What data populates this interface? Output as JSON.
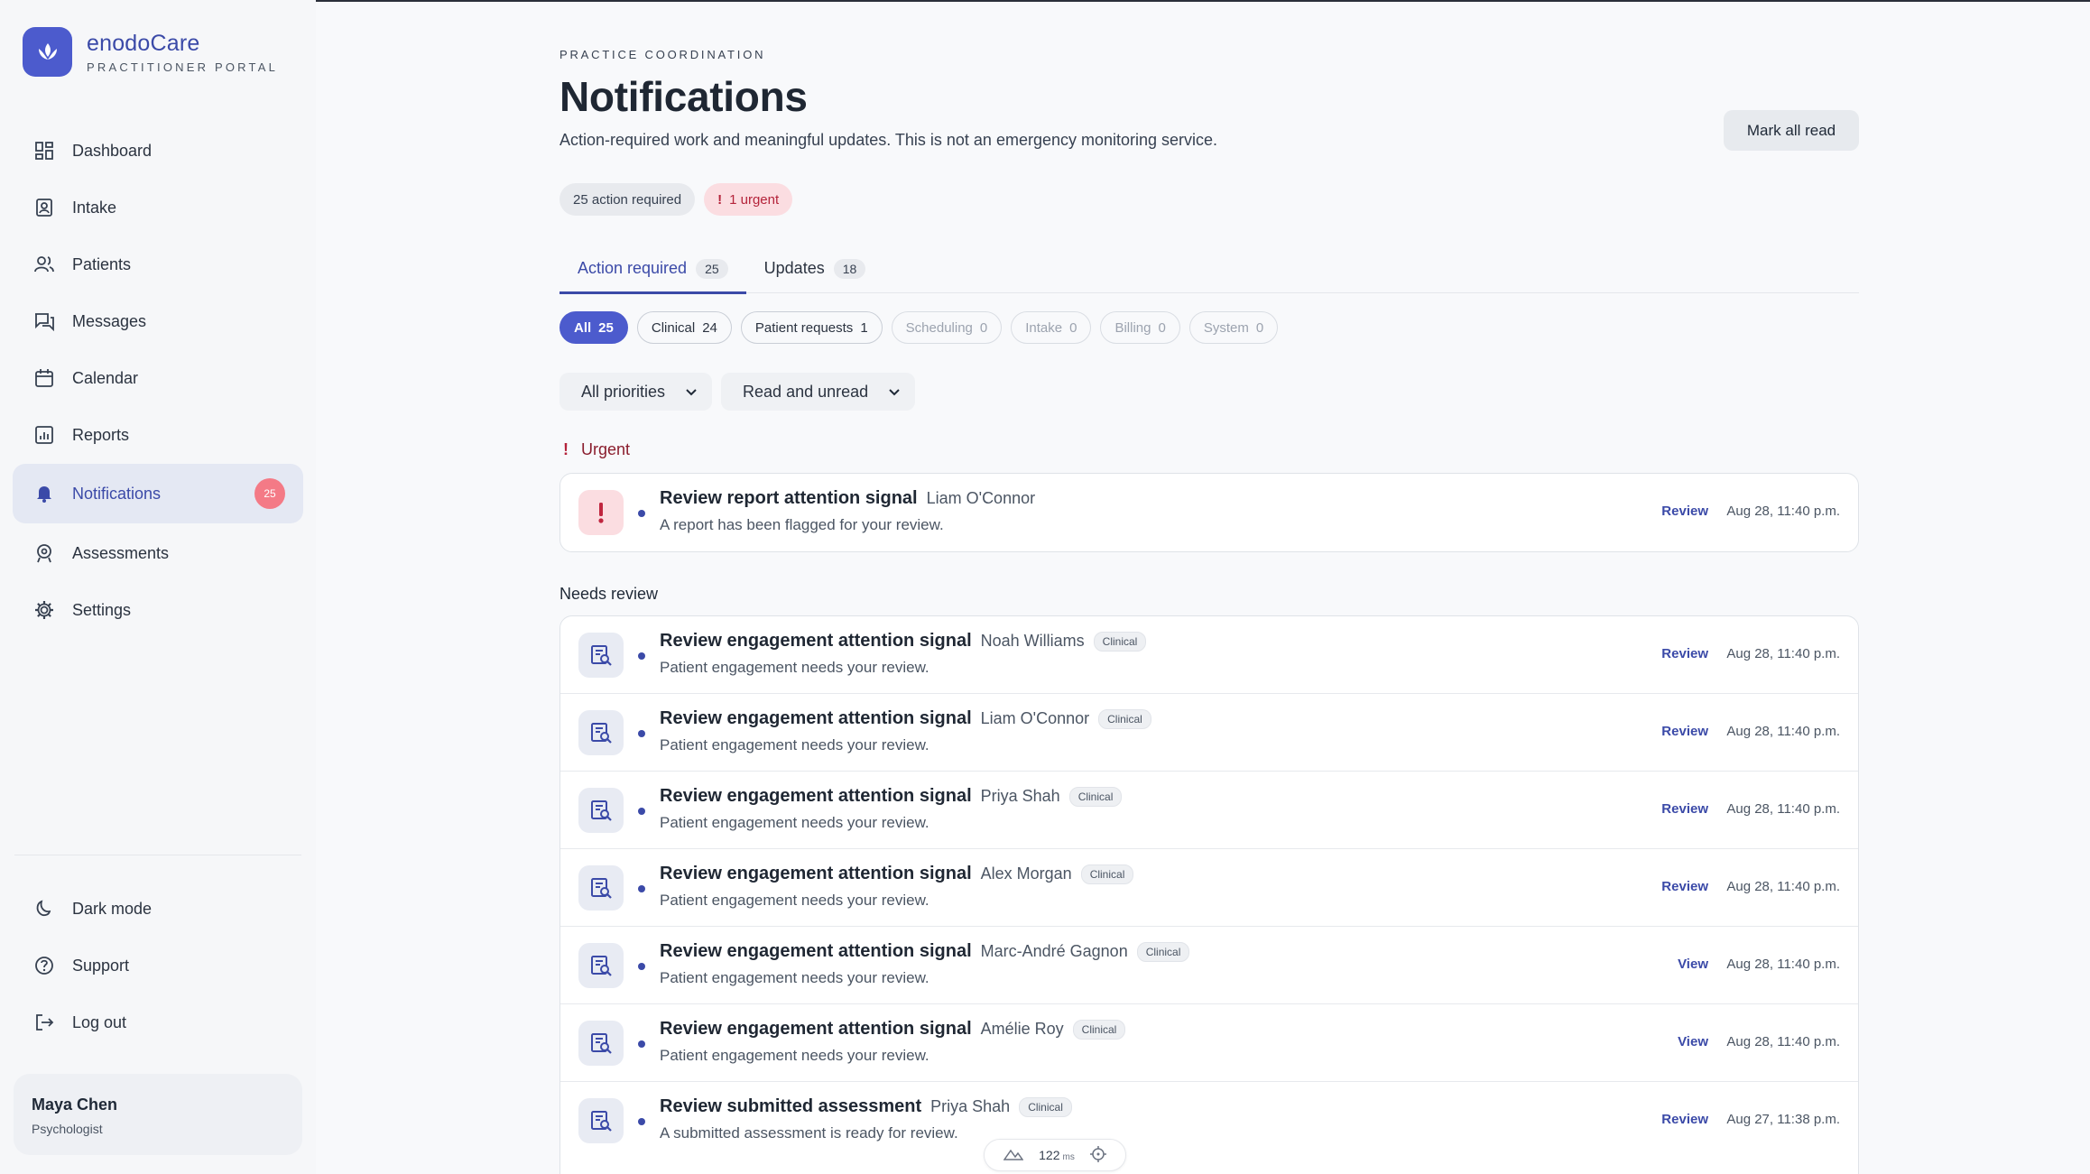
{
  "brand": {
    "name": "enodoCare",
    "subtitle": "PRACTITIONER PORTAL"
  },
  "nav": {
    "items": [
      {
        "label": "Dashboard",
        "icon": "dashboard-icon"
      },
      {
        "label": "Intake",
        "icon": "intake-icon"
      },
      {
        "label": "Patients",
        "icon": "patients-icon"
      },
      {
        "label": "Messages",
        "icon": "messages-icon"
      },
      {
        "label": "Calendar",
        "icon": "calendar-icon"
      },
      {
        "label": "Reports",
        "icon": "reports-icon"
      },
      {
        "label": "Notifications",
        "icon": "bell-icon",
        "badge": "25",
        "active": true
      },
      {
        "label": "Assessments",
        "icon": "assessments-icon"
      },
      {
        "label": "Settings",
        "icon": "gear-icon"
      }
    ],
    "bottom": [
      {
        "label": "Dark mode",
        "icon": "moon-icon"
      },
      {
        "label": "Support",
        "icon": "help-icon"
      },
      {
        "label": "Log out",
        "icon": "logout-icon"
      }
    ]
  },
  "user": {
    "name": "Maya Chen",
    "role": "Psychologist"
  },
  "header": {
    "eyebrow": "PRACTICE COORDINATION",
    "title": "Notifications",
    "subtitle": "Action-required work and meaningful updates. This is not an emergency monitoring service.",
    "mark_all_label": "Mark all read"
  },
  "summary": {
    "action_required": "25 action required",
    "urgent_icon": "!",
    "urgent": "1 urgent"
  },
  "tabs": [
    {
      "label": "Action required",
      "count": "25",
      "active": true
    },
    {
      "label": "Updates",
      "count": "18",
      "active": false
    }
  ],
  "filters": [
    {
      "label": "All",
      "count": "25",
      "state": "active"
    },
    {
      "label": "Clinical",
      "count": "24",
      "state": "enabled"
    },
    {
      "label": "Patient requests",
      "count": "1",
      "state": "enabled"
    },
    {
      "label": "Scheduling",
      "count": "0",
      "state": "disabled"
    },
    {
      "label": "Intake",
      "count": "0",
      "state": "disabled"
    },
    {
      "label": "Billing",
      "count": "0",
      "state": "disabled"
    },
    {
      "label": "System",
      "count": "0",
      "state": "disabled"
    }
  ],
  "selects": {
    "priority": "All priorities",
    "read_state": "Read and unread"
  },
  "sections": {
    "urgent_icon": "!",
    "urgent_label": "Urgent",
    "review_label": "Needs review"
  },
  "urgent_items": [
    {
      "title": "Review report attention signal",
      "patient": "Liam O'Connor",
      "tag": "",
      "desc": "A report has been flagged for your review.",
      "action": "Review",
      "time": "Aug 28, 11:40 p.m."
    }
  ],
  "review_items": [
    {
      "title": "Review engagement attention signal",
      "patient": "Noah Williams",
      "tag": "Clinical",
      "desc": "Patient engagement needs your review.",
      "action": "Review",
      "time": "Aug 28, 11:40 p.m."
    },
    {
      "title": "Review engagement attention signal",
      "patient": "Liam O'Connor",
      "tag": "Clinical",
      "desc": "Patient engagement needs your review.",
      "action": "Review",
      "time": "Aug 28, 11:40 p.m."
    },
    {
      "title": "Review engagement attention signal",
      "patient": "Priya Shah",
      "tag": "Clinical",
      "desc": "Patient engagement needs your review.",
      "action": "Review",
      "time": "Aug 28, 11:40 p.m."
    },
    {
      "title": "Review engagement attention signal",
      "patient": "Alex Morgan",
      "tag": "Clinical",
      "desc": "Patient engagement needs your review.",
      "action": "Review",
      "time": "Aug 28, 11:40 p.m."
    },
    {
      "title": "Review engagement attention signal",
      "patient": "Marc-André Gagnon",
      "tag": "Clinical",
      "desc": "Patient engagement needs your review.",
      "action": "View",
      "time": "Aug 28, 11:40 p.m."
    },
    {
      "title": "Review engagement attention signal",
      "patient": "Amélie Roy",
      "tag": "Clinical",
      "desc": "Patient engagement needs your review.",
      "action": "View",
      "time": "Aug 28, 11:40 p.m."
    },
    {
      "title": "Review submitted assessment",
      "patient": "Priya Shah",
      "tag": "Clinical",
      "desc": "A submitted assessment is ready for review.",
      "action": "Review",
      "time": "Aug 27, 11:38 p.m."
    }
  ],
  "perf": {
    "value": "122",
    "unit": "ms"
  },
  "colors": {
    "accent": "#4c5bcd",
    "urgent": "#b4233a",
    "badge": "#f47a86"
  }
}
